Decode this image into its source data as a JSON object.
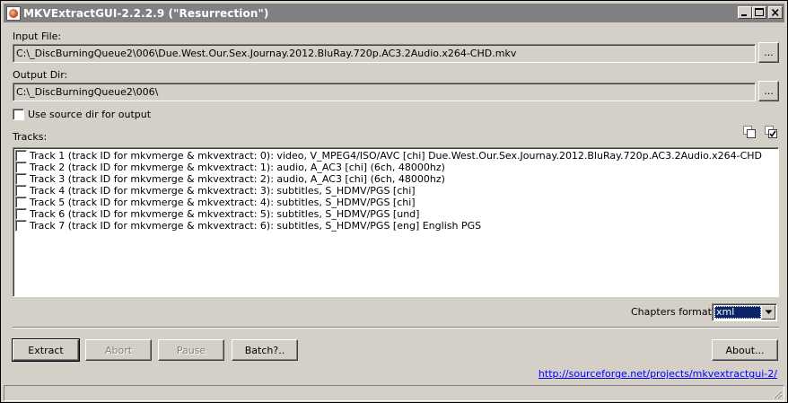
{
  "window": {
    "title": "MKVExtractGUI-2.2.2.9 (\"Resurrection\")"
  },
  "input": {
    "label": "Input File:",
    "value": "C:\\_DiscBurningQueue2\\006\\Due.West.Our.Sex.Journay.2012.BluRay.720p.AC3.2Audio.x264-CHD.mkv",
    "browse_label": "..."
  },
  "output": {
    "label": "Output Dir:",
    "value": "C:\\_DiscBurningQueue2\\006\\",
    "browse_label": "..."
  },
  "use_source_dir": {
    "label": "Use source dir for output",
    "checked": false
  },
  "tracks": {
    "label": "Tracks:",
    "items": [
      {
        "label": "Track 1 (track ID for mkvmerge & mkvextract: 0): video, V_MPEG4/ISO/AVC [chi] Due.West.Our.Sex.Journay.2012.BluRay.720p.AC3.2Audio.x264-CHD",
        "checked": false
      },
      {
        "label": "Track 2 (track ID for mkvmerge & mkvextract: 1): audio, A_AC3 [chi]  (6ch, 48000hz)",
        "checked": false
      },
      {
        "label": "Track 3 (track ID for mkvmerge & mkvextract: 2): audio, A_AC3 [chi]  (6ch, 48000hz)",
        "checked": false
      },
      {
        "label": "Track 4 (track ID for mkvmerge & mkvextract: 3): subtitles, S_HDMV/PGS [chi]",
        "checked": false
      },
      {
        "label": "Track 5 (track ID for mkvmerge & mkvextract: 4): subtitles, S_HDMV/PGS [chi]",
        "checked": false
      },
      {
        "label": "Track 6 (track ID for mkvmerge & mkvextract: 5): subtitles, S_HDMV/PGS [und]",
        "checked": false
      },
      {
        "label": "Track 7 (track ID for mkvmerge & mkvextract: 6): subtitles, S_HDMV/PGS [eng] English PGS",
        "checked": false
      }
    ]
  },
  "chapters": {
    "label": "Chapters format:",
    "selected": "xml"
  },
  "buttons": {
    "extract": "Extract",
    "abort": "Abort",
    "pause": "Pause",
    "batch": "Batch?..",
    "about": "About..."
  },
  "link": {
    "text": "http://sourceforge.net/projects/mkvextractgui-2/"
  },
  "icons": {
    "app": "app-icon",
    "select_all": "select-all-icon",
    "check_all": "check-all-icon"
  },
  "colors": {
    "face": "#d4d0c8",
    "titlebar_inactive": "#808080",
    "selection": "#0a246a",
    "link": "#0000ff"
  }
}
